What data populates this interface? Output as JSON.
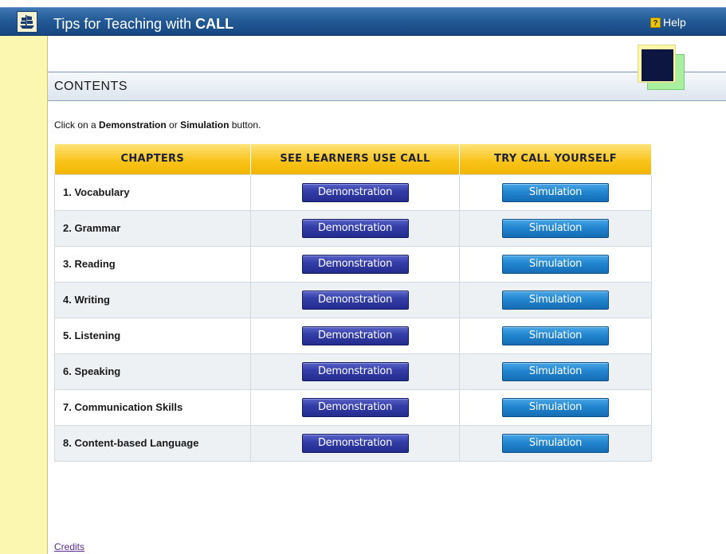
{
  "header": {
    "title_prefix": "Tips for Teaching with ",
    "title_bold": "CALL",
    "help_label": "Help",
    "help_icon_glyph": "?"
  },
  "section": {
    "title": "CONTENTS"
  },
  "instruction": {
    "prefix": "Click on a ",
    "demo_word": "Demonstration",
    "middle": " or ",
    "sim_word": "Simulation",
    "suffix": " button."
  },
  "table": {
    "headers": [
      "CHAPTERS",
      "SEE LEARNERS USE CALL",
      "TRY CALL YOURSELF"
    ],
    "rows": [
      {
        "chapter": "1. Vocabulary",
        "demo": "Demonstration",
        "sim": "Simulation"
      },
      {
        "chapter": "2. Grammar",
        "demo": "Demonstration",
        "sim": "Simulation"
      },
      {
        "chapter": "3. Reading",
        "demo": "Demonstration",
        "sim": "Simulation"
      },
      {
        "chapter": "4. Writing",
        "demo": "Demonstration",
        "sim": "Simulation"
      },
      {
        "chapter": "5. Listening",
        "demo": "Demonstration",
        "sim": "Simulation"
      },
      {
        "chapter": "6. Speaking",
        "demo": "Demonstration",
        "sim": "Simulation"
      },
      {
        "chapter": "7. Communication Skills",
        "demo": "Demonstration",
        "sim": "Simulation"
      },
      {
        "chapter": "8. Content-based Language",
        "demo": "Demonstration",
        "sim": "Simulation"
      }
    ]
  },
  "footer": {
    "credits_label": "Credits"
  },
  "colors": {
    "header_blue": "#235a97",
    "left_column_yellow": "#fbf6b0",
    "table_header_gold": "#f9c41c",
    "demo_button": "#333ea7",
    "sim_button": "#2286cf",
    "link_purple": "#5a2b8f"
  },
  "icons": {
    "logo": "ship-logo-icon",
    "help": "help-icon"
  }
}
